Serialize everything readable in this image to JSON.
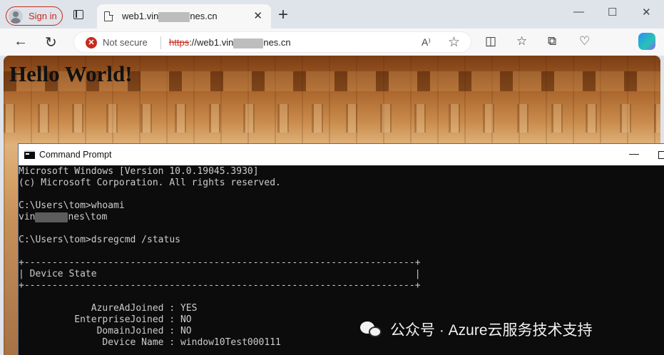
{
  "browser": {
    "signin_label": "Sign in",
    "tab": {
      "title_prefix": "web1.vin",
      "title_suffix": "nes.cn",
      "close": "✕"
    },
    "new_tab": "+",
    "window_controls": {
      "minimize": "—",
      "maximize": "☐",
      "close": "✕"
    },
    "nav": {
      "back": "←",
      "refresh": "↻"
    },
    "address": {
      "security_label": "Not secure",
      "scheme": "https",
      "separator": "://",
      "host_prefix": "web1.vin",
      "host_suffix": "nes.cn"
    },
    "icons": [
      "read-aloud-icon",
      "favorite-star-icon",
      "split-screen-icon",
      "favorites-icon",
      "collections-icon",
      "browser-essentials-icon",
      "copilot-icon"
    ],
    "accent_color": "#c42b1c"
  },
  "page": {
    "heading": "Hello World!"
  },
  "cmd": {
    "title": "Command Prompt",
    "lines": {
      "l1": "Microsoft Windows [Version 10.0.19045.3930]",
      "l2": "(c) Microsoft Corporation. All rights reserved.",
      "l4": "C:\\Users\\tom>whoami",
      "l5_prefix": "vin",
      "l5_suffix": "nes\\tom",
      "l7": "C:\\Users\\tom>dsregcmd /status",
      "l9": "+----------------------------------------------------------------------+",
      "l10": "| Device State                                                         |",
      "l11": "+----------------------------------------------------------------------+",
      "l13": "             AzureAdJoined : YES",
      "l14": "          EnterpriseJoined : NO",
      "l15": "              DomainJoined : NO",
      "l16": "               Device Name : window10Test000111"
    }
  },
  "watermark": {
    "text": "公众号 · Azure云服务技术支持"
  }
}
